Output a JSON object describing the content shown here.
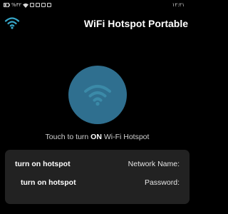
{
  "status_bar": {
    "left_text": "%٣٢",
    "clock": "١٢:٢١",
    "icons": [
      "battery-icon",
      "wifi-icon",
      "notification-icon",
      "notification-icon",
      "notification-icon",
      "notification-icon"
    ]
  },
  "header": {
    "icon": "wifi-icon",
    "title": "WiFi Hotspot Portable"
  },
  "main": {
    "toggle_icon": "wifi-icon",
    "hint_prefix": "Touch to turn ",
    "hint_state": "ON",
    "hint_suffix": " Wi-Fi Hotspot"
  },
  "details": {
    "network_name_value": "turn on hotspot",
    "network_name_label": "Network Name:",
    "password_value": "turn on hotspot",
    "password_label": "Password:"
  },
  "colors": {
    "background": "#000000",
    "accent": "#37a6c8",
    "button": "#2f6f8f",
    "panel": "#222222"
  }
}
